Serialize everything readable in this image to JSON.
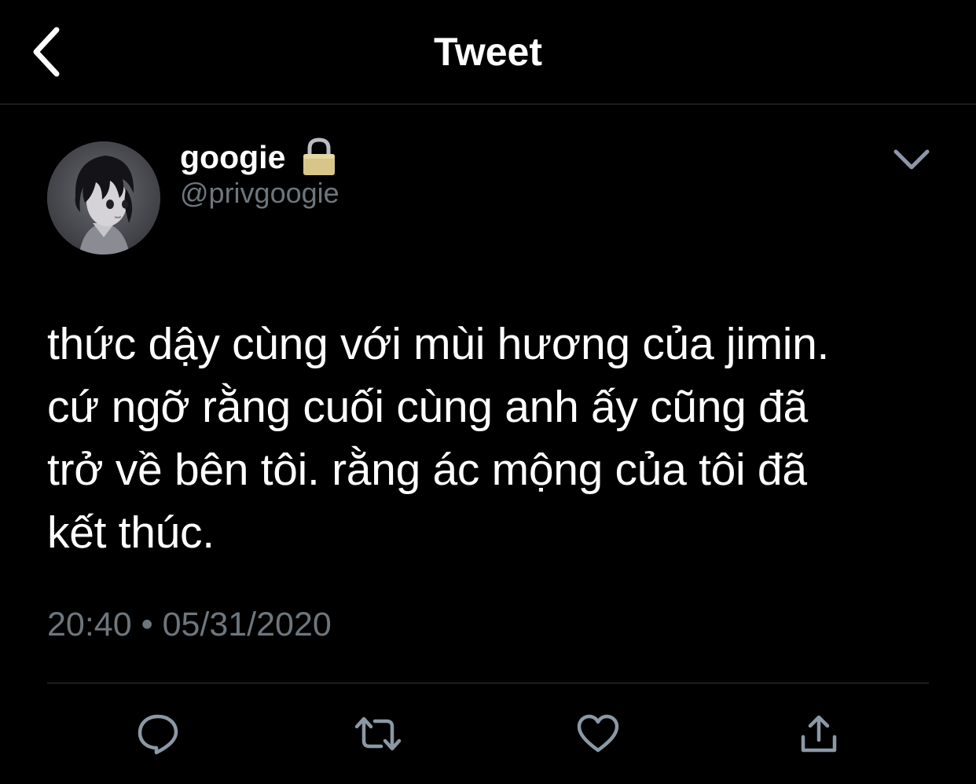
{
  "header": {
    "title": "Tweet",
    "back_icon": "chevron-left-icon"
  },
  "tweet": {
    "author": {
      "name": "googie",
      "handle": "@privgoogie",
      "protected_icon": "lock-icon",
      "avatar": "anime-character-avatar"
    },
    "more_icon": "chevron-down-icon",
    "text_lines": [
      "thức dậy cùng với mùi hương của jimin.",
      "cứ ngỡ rằng cuối cùng anh ấy cũng đã",
      "trở về bên tôi. rằng ác mộng của tôi đã",
      "kết thúc."
    ],
    "time": "20:40",
    "separator": "•",
    "date": "05/31/2020"
  },
  "actions": [
    {
      "icon": "reply-icon"
    },
    {
      "icon": "retweet-icon"
    },
    {
      "icon": "like-icon"
    },
    {
      "icon": "share-icon"
    }
  ],
  "colors": {
    "background": "#000000",
    "text": "#ffffff",
    "secondary_text": "#6e767d",
    "divider": "#2f3336",
    "icon": "#8b98a5",
    "lock": "#d8c58a"
  }
}
